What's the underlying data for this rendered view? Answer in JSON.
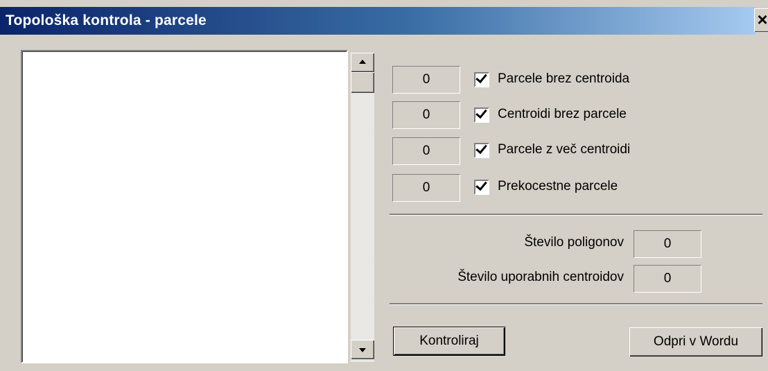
{
  "window": {
    "title": "Topološka kontrola - parcele",
    "close_label": "×"
  },
  "checks": [
    {
      "count": "0",
      "label": "Parcele brez centroida",
      "checked": true
    },
    {
      "count": "0",
      "label": "Centroidi brez parcele",
      "checked": true
    },
    {
      "count": "0",
      "label": "Parcele z več centroidi",
      "checked": true
    },
    {
      "count": "0",
      "label": "Prekocestne parcele",
      "checked": true
    }
  ],
  "stats": {
    "polygons_label": "Število poligonov",
    "polygons_value": "0",
    "centroids_label": "Število uporabnih centroidov",
    "centroids_value": "0"
  },
  "buttons": {
    "check": "Kontroliraj",
    "open_word": "Odpri v Wordu"
  }
}
